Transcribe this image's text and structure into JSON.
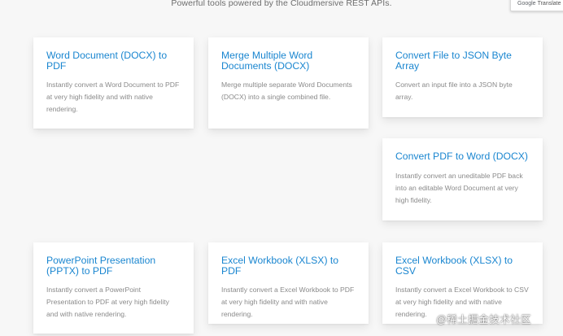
{
  "header": {
    "subtitle": "Powerful tools powered by the Cloudmersive REST APIs."
  },
  "translate_widget": {
    "brand": "Google",
    "label": "Translate"
  },
  "cards": [
    {
      "title": "Word Document (DOCX) to PDF",
      "description": "Instantly convert a Word Document to PDF at very high fidelity and with native rendering."
    },
    {
      "title": "Merge Multiple Word Documents (DOCX)",
      "description": "Merge multiple separate Word Documents (DOCX) into a single combined file."
    },
    {
      "title": "Convert File to JSON Byte Array",
      "description": "Convert an input file into a JSON byte array."
    },
    {
      "title": "Convert PDF to Word (DOCX)",
      "description": "Instantly convert an uneditable PDF back into an editable Word Document at very high fidelity."
    },
    {
      "title": "PowerPoint Presentation (PPTX) to PDF",
      "description": "Instantly convert a PowerPoint Presentation to PDF at very high fidelity and with native rendering."
    },
    {
      "title": "Excel Workbook (XLSX) to PDF",
      "description": "Instantly convert a Excel Workbook to PDF at very high fidelity and with native rendering."
    },
    {
      "title": "Excel Workbook (XLSX) to CSV",
      "description": "Instantly convert a Excel Workbook to CSV at very high fidelity and with native rendering."
    }
  ],
  "watermark": "@稀土掘金技术社区",
  "colors": {
    "title": "#1a86d0",
    "description": "#8a8a8a",
    "background": "#f7f7f7",
    "card": "#ffffff"
  }
}
